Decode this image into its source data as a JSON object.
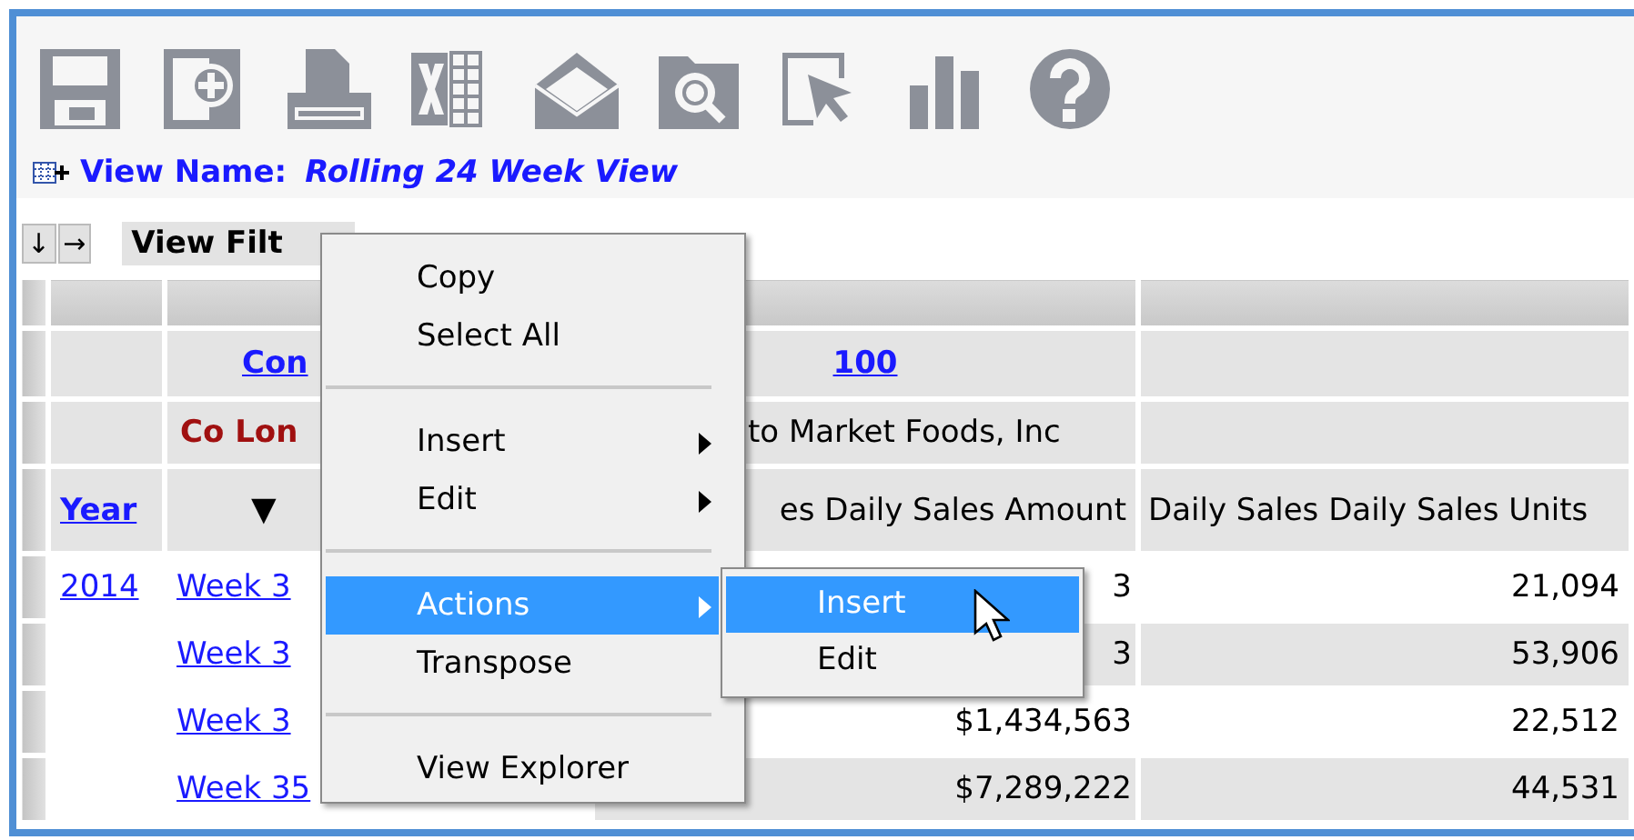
{
  "toolbar": [
    {
      "kind": "save"
    },
    {
      "kind": "add"
    },
    {
      "kind": "print"
    },
    {
      "kind": "excel"
    },
    {
      "kind": "mail"
    },
    {
      "kind": "find"
    },
    {
      "kind": "pointer"
    },
    {
      "kind": "chart"
    },
    {
      "kind": "help"
    }
  ],
  "view_name": {
    "label": "View Name:",
    "value": "Rolling 24 Week View"
  },
  "sort_buttons": [
    "↓",
    "→"
  ],
  "view_filter": "View Filt",
  "table": {
    "header_rows": [
      {
        "cells": [
          {
            "kind": "blank"
          },
          {
            "kind": "link",
            "text": "Con"
          },
          {
            "kind": "link",
            "text": "100"
          },
          {
            "kind": "blank"
          }
        ]
      },
      {
        "cells": [
          {
            "kind": "blank"
          },
          {
            "kind": "label",
            "text": "Co Lon"
          },
          {
            "kind": "text",
            "text": "to Market Foods, Inc"
          },
          {
            "kind": "blank"
          }
        ]
      },
      {
        "cells": [
          {
            "kind": "link",
            "text": "Year"
          },
          {
            "kind": "arrow",
            "text": "▼"
          },
          {
            "kind": "text",
            "text": "es Daily Sales Amount"
          },
          {
            "kind": "text",
            "text": "Daily Sales Daily Sales Units"
          }
        ]
      }
    ],
    "rows": [
      {
        "year": "2014",
        "week": "Week 3",
        "amount": "3",
        "units": "21,094"
      },
      {
        "week": "Week 3",
        "amount": "3",
        "units": "53,906"
      },
      {
        "week": "Week 3",
        "amount": "$1,434,563",
        "units": "22,512"
      },
      {
        "week": "Week 35",
        "amount": "$7,289,222",
        "units": "44,531"
      }
    ]
  },
  "context_menu": {
    "items": [
      {
        "kind": "item",
        "label": "Copy",
        "has_submenu": false,
        "selected": false
      },
      {
        "kind": "item",
        "label": "Select All",
        "has_submenu": false,
        "selected": false
      },
      {
        "kind": "separator"
      },
      {
        "kind": "item",
        "label": "Insert",
        "has_submenu": true,
        "selected": false
      },
      {
        "kind": "item",
        "label": "Edit",
        "has_submenu": true,
        "selected": false
      },
      {
        "kind": "separator"
      },
      {
        "kind": "item",
        "label": "Actions",
        "has_submenu": true,
        "selected": true
      },
      {
        "kind": "item",
        "label": "Transpose",
        "has_submenu": false,
        "selected": false
      },
      {
        "kind": "separator"
      },
      {
        "kind": "item",
        "label": "View Explorer",
        "has_submenu": false,
        "selected": false
      }
    ]
  },
  "submenu": {
    "items": [
      {
        "label": "Insert",
        "selected": true
      },
      {
        "label": "Edit",
        "selected": false
      }
    ]
  }
}
